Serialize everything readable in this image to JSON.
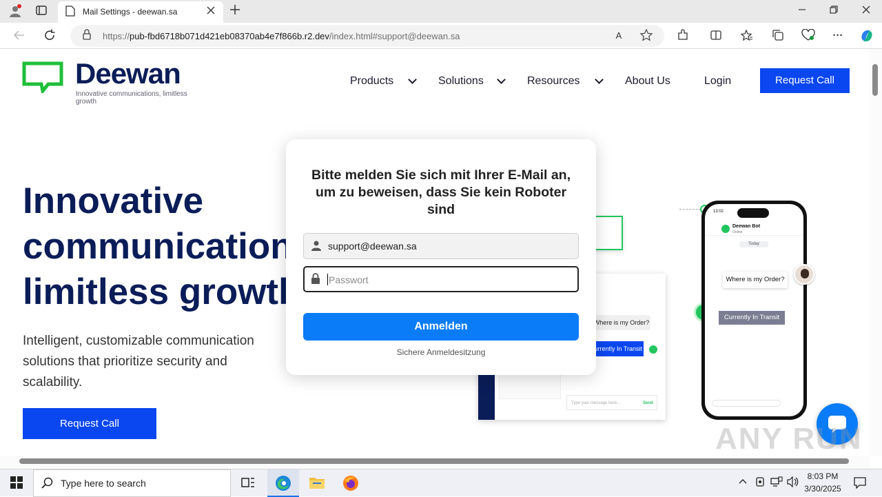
{
  "browser": {
    "tab_title": "Mail Settings - deewan.sa",
    "url_prefix": "https://",
    "url_host": "pub-fbd6718b071d421eb08370ab4e7f866b.r2.dev",
    "url_path": "/index.html#support@deewan.sa"
  },
  "site": {
    "brand": "Deewan",
    "tagline": "Innovative communications, limitless growth",
    "nav": [
      {
        "label": "Products"
      },
      {
        "label": "Solutions"
      },
      {
        "label": "Resources"
      },
      {
        "label": "About Us"
      },
      {
        "label": "Login"
      }
    ],
    "request_call": "Request Call",
    "hero_line1": "Innovative",
    "hero_line2": "communications,",
    "hero_line3": "limitless growth.",
    "hero_sub": "Intelligent, customizable communication solutions that prioritize security and scalability.",
    "hero_button": "Request Call"
  },
  "illustration": {
    "card_question": "Where is my Order?",
    "card_answer": "Currently In Transit",
    "card_placeholder": "Type your message here...",
    "card_send": "Send",
    "phone_time": "13:02",
    "phone_contact": "Deewan Bot",
    "phone_status": "Online",
    "phone_day": "Today",
    "phone_question": "Where is my Order?",
    "phone_answer": "Currently In Transit"
  },
  "modal": {
    "title": "Bitte melden Sie sich mit Ihrer E-Mail an, um zu beweisen, dass Sie kein Roboter sind",
    "email_value": "support@deewan.sa",
    "password_placeholder": "Passwort",
    "login_button": "Anmelden",
    "secure_text": "Sichere Anmeldesitzung"
  },
  "taskbar": {
    "search_placeholder": "Type here to search",
    "time": "8:03 PM",
    "date": "3/30/2025"
  },
  "watermark": "ANY RUN",
  "colors": {
    "brand_navy": "#0b1d58",
    "brand_green": "#22c55e",
    "cta_blue": "#0a47f0",
    "login_blue": "#0a7cf7"
  }
}
